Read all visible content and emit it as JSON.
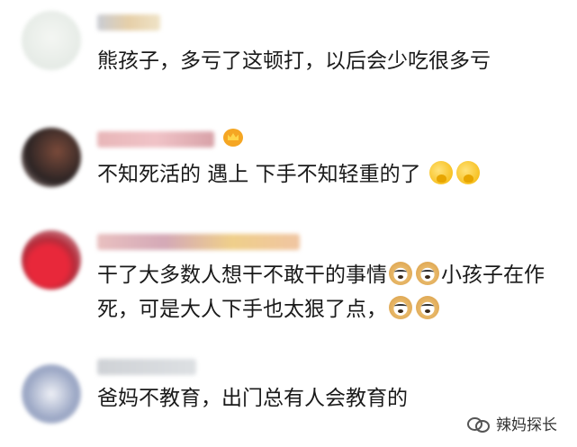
{
  "comments": [
    {
      "text": "熊孩子，多亏了这顿打，以后会少吃很多亏",
      "emojis": []
    },
    {
      "text": "不知死活的 遇上 下手不知轻重的了",
      "emojis": [
        "thinking-face-icon",
        "thinking-face-icon"
      ],
      "badge": "crown-icon"
    },
    {
      "text_line1": "干了大多数人想干不敢干的事情",
      "text_line1_tail": "小孩子在作",
      "text_line2": "死，可是大人下手也太狠了点，",
      "emojis": [
        "doge-icon",
        "doge-icon",
        "doge-icon",
        "doge-icon"
      ]
    },
    {
      "text": "爸妈不教育，出门总有人会教育的",
      "emojis": []
    }
  ],
  "watermark": {
    "label": "辣妈探长",
    "icon": "wechat-icon"
  },
  "colors": {
    "text": "#1a1a1a",
    "emoji_yellow": "#f4b400",
    "badge": "#f5a623"
  }
}
